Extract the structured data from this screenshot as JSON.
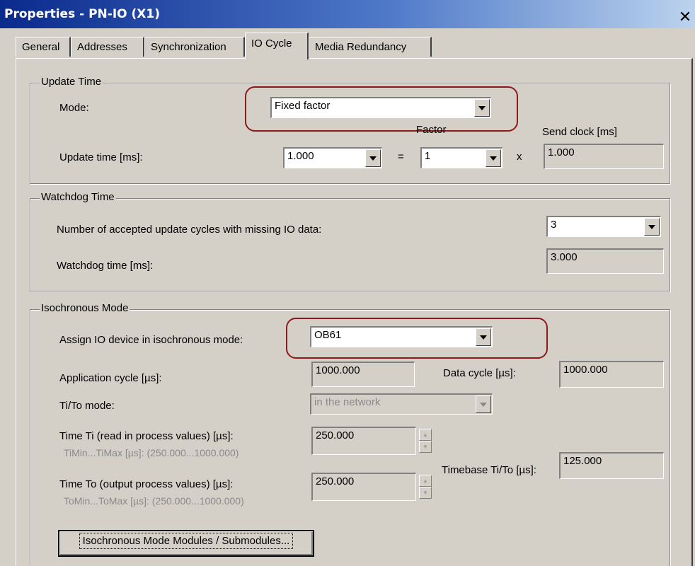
{
  "window": {
    "title": "Properties - PN-IO (X1)",
    "close_glyph": "✕"
  },
  "tabs": [
    {
      "label": "General"
    },
    {
      "label": "Addresses"
    },
    {
      "label": "Synchronization"
    },
    {
      "label": "IO Cycle"
    },
    {
      "label": "Media Redundancy"
    }
  ],
  "update_time": {
    "group_title": "Update Time",
    "mode_label": "Mode:",
    "mode_value": "Fixed factor",
    "update_time_label": "Update time [ms]:",
    "update_time_value": "1.000",
    "equals": "=",
    "factor_label": "Factor",
    "factor_value": "1",
    "times": "x",
    "send_clock_label": "Send clock [ms]",
    "send_clock_value": "1.000"
  },
  "watchdog": {
    "group_title": "Watchdog Time",
    "cycles_label": "Number of accepted update cycles with missing IO data:",
    "cycles_value": "3",
    "watchdog_time_label": "Watchdog time [ms]:",
    "watchdog_time_value": "3.000"
  },
  "isochronous": {
    "group_title": "Isochronous Mode",
    "assign_label": "Assign IO device in isochronous mode:",
    "assign_value": "OB61",
    "app_cycle_label": "Application cycle [µs]:",
    "app_cycle_value": "1000.000",
    "data_cycle_label": "Data cycle [µs]:",
    "data_cycle_value": "1000.000",
    "tito_mode_label": "Ti/To mode:",
    "tito_mode_value": "in the network",
    "ti_label": "Time Ti (read in process values) [µs]:",
    "ti_range": "TiMin...TiMax [µs]:   (250.000...1000.000)",
    "ti_value": "250.000",
    "to_label": "Time To (output process values) [µs]:",
    "to_range": "ToMin...ToMax [µs]:  (250.000...1000.000)",
    "to_value": "250.000",
    "timebase_label": "Timebase Ti/To [µs]:",
    "timebase_value": "125.000",
    "modules_button": "Isochronous Mode Modules / Submodules..."
  },
  "colors": {
    "dialog_bg": "#d4d0c8",
    "titlebar_start": "#0a2a8c",
    "titlebar_end": "#bcd3ee",
    "highlight_ring": "#8b1a1a"
  },
  "icons": {
    "combo_arrow": "chevron-down-icon",
    "spin_up": "spin-up-icon",
    "spin_down": "spin-down-icon",
    "close": "close-icon"
  }
}
